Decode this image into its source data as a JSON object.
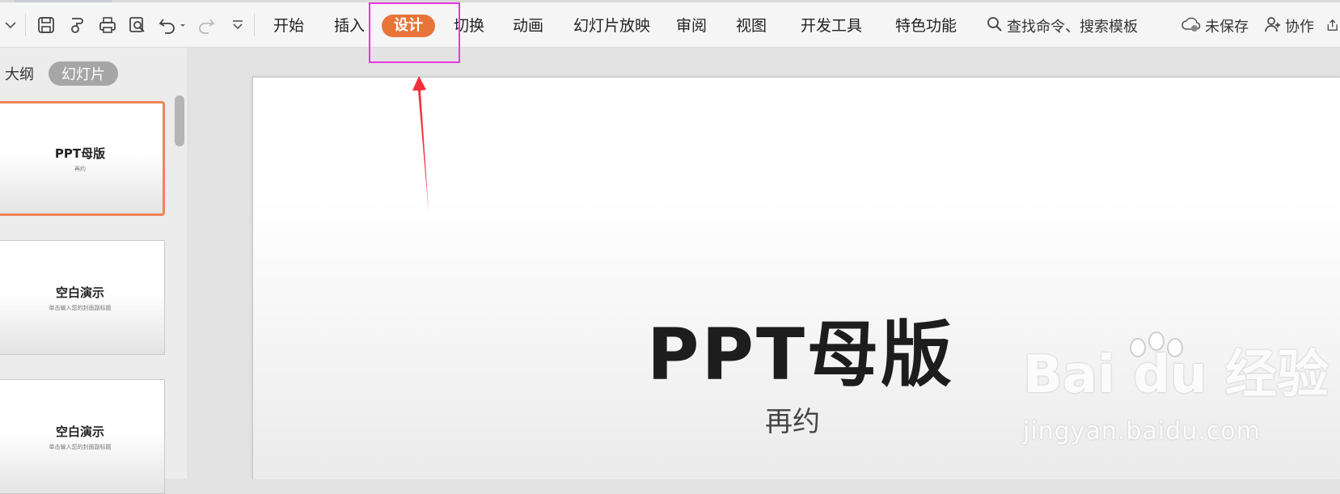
{
  "toolbar": {
    "tabs": [
      {
        "label": "开始"
      },
      {
        "label": "插入"
      },
      {
        "label": "设计"
      },
      {
        "label": "切换"
      },
      {
        "label": "动画"
      },
      {
        "label": "幻灯片放映"
      },
      {
        "label": "审阅"
      },
      {
        "label": "视图"
      },
      {
        "label": "开发工具"
      },
      {
        "label": "特色功能"
      }
    ],
    "active_tab": "设计",
    "search_label": "查找命令、搜索模板",
    "unsaved_label": "未保存",
    "collab_label": "协作",
    "icons": [
      "chevron-down-icon",
      "save-icon",
      "format-painter-icon",
      "print-icon",
      "print-preview-icon",
      "undo-icon",
      "redo-icon",
      "customize-icon",
      "search-icon",
      "cloud-icon",
      "add-user-icon",
      "share-icon"
    ]
  },
  "left_panel": {
    "tabs": [
      {
        "label": "大纲"
      },
      {
        "label": "幻灯片"
      }
    ],
    "active_tab": "幻灯片",
    "slides": [
      {
        "title": "PPT母版",
        "subtitle": "再约"
      },
      {
        "title": "空白演示",
        "subtitle": "单击输入您的封面副标题"
      },
      {
        "title": "空白演示",
        "subtitle": "单击输入您的封面副标题"
      }
    ]
  },
  "slide": {
    "title": "PPT母版",
    "subtitle": "再约"
  },
  "watermark": {
    "brand": "Bai du 经验",
    "url": "jingyan.baidu.com"
  },
  "colors": {
    "accent": "#e8743a",
    "highlight_box": "#e539e0",
    "arrow": "#f0303a",
    "selected_thumb": "#f08458"
  }
}
